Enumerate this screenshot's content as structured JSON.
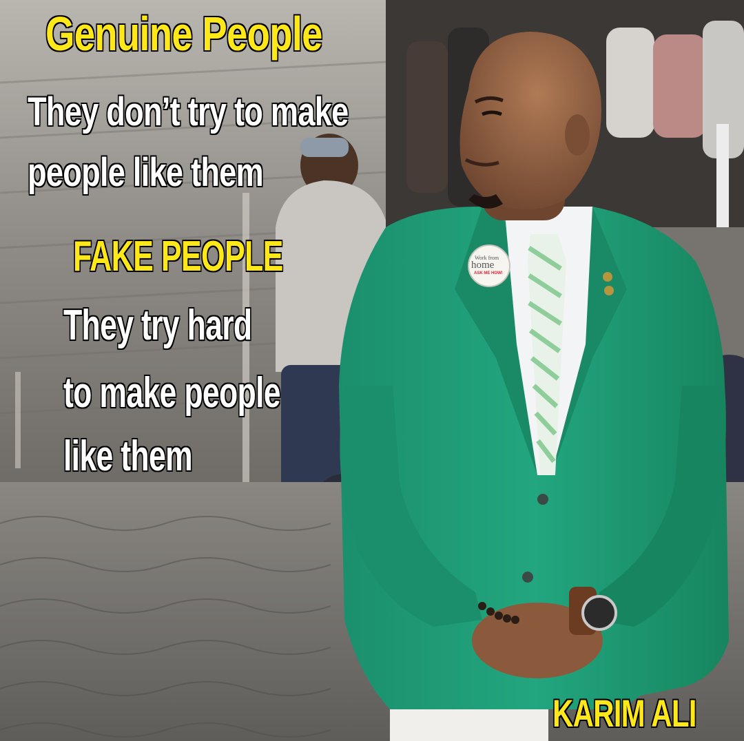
{
  "captions": {
    "genuine_title": "Genuine People",
    "genuine_line_1": "They don’t try to make",
    "genuine_line_2": "people like them",
    "fake_title": "FAKE PEOPLE",
    "fake_line_1": "They try hard",
    "fake_line_2": "to make people",
    "fake_line_3": "like them",
    "brand": "KARIM ALI"
  },
  "badge": {
    "line_1": "Work from",
    "line_2": "home",
    "line_3": "ASK ME HOW!"
  },
  "colors": {
    "caption_accent": "#ffe81a",
    "caption_main": "#ffffff",
    "jacket": "#1ea37c",
    "background_stone": "#8d8a85"
  }
}
